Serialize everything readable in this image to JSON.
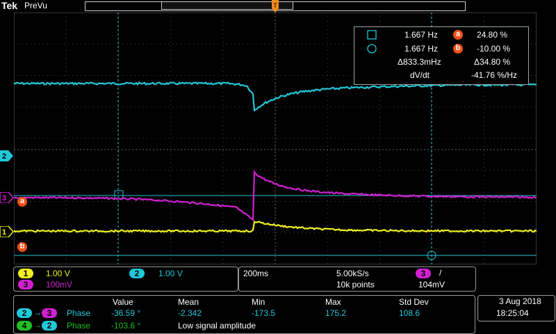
{
  "brand": "Tek",
  "mode": "PreVu",
  "colors": {
    "ch1": "#f0f020",
    "ch2": "#20c8d8",
    "ch3": "#d020d0",
    "ch4": "#20c020",
    "cursor": "#f05018",
    "grid": "#6a6a6a"
  },
  "markers": {
    "ch1": "1",
    "ch2": "2",
    "ch3": "3",
    "cursor_a": "a",
    "cursor_b": "b"
  },
  "cursor_readout": {
    "time_a": "1.667 Hz",
    "val_a": "24.80 %",
    "time_b": "1.667 Hz",
    "val_b": "-10.00 %",
    "delta_t": "Δ833.3mHz",
    "delta_v": "Δ34.80 %",
    "dvdt_label": "dV/dt",
    "dvdt": "-41.76 %/Hz"
  },
  "channels": {
    "ch1": {
      "num": "1",
      "scale": "1.00 V"
    },
    "ch2": {
      "num": "2",
      "scale": "1.00 V"
    },
    "ch3": {
      "num": "3",
      "scale": "100mV"
    }
  },
  "horizontal": {
    "timebase": "200ms",
    "sample_rate": "5.00kS/s",
    "record": "10k points",
    "trig_source": "3",
    "trig_slope": "/",
    "trig_level": "104mV"
  },
  "measurements": {
    "headers": [
      "Value",
      "Mean",
      "Min",
      "Max",
      "Std Dev"
    ],
    "rows": [
      {
        "src": "2",
        "dst": "3",
        "name": "Phase",
        "value": "-36.59 °",
        "mean": "-2.342",
        "min": "-173.5",
        "max": "175.2",
        "std": "108.6"
      },
      {
        "src": "4",
        "dst": "2",
        "name": "Phase",
        "value": "-103.6 °",
        "note": "Low signal amplitude"
      }
    ]
  },
  "date": "3 Aug 2018",
  "time": "18:25:04"
}
